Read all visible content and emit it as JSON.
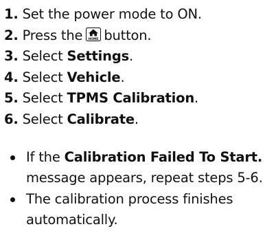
{
  "steps": [
    {
      "num": "1.",
      "text": "Set the power mode to ON."
    },
    {
      "num": "2.",
      "text_before": "Press the",
      "icon": "home-icon",
      "icon_label": "HOME",
      "text_after": "button."
    },
    {
      "num": "3.",
      "text": "Select",
      "bold": "Settings",
      "end": "."
    },
    {
      "num": "4.",
      "text": "Select",
      "bold": "Vehicle",
      "end": "."
    },
    {
      "num": "5.",
      "text": "Select",
      "bold": "TPMS Calibration",
      "end": "."
    },
    {
      "num": "6.",
      "text": "Select",
      "bold": "Calibrate",
      "end": "."
    }
  ],
  "notes": [
    {
      "text_before": "If the",
      "bold": "Calibration Failed To Start.",
      "text_after": "message appears, repeat steps 5-6."
    },
    {
      "text": "The calibration process finishes automatically."
    }
  ],
  "colors": {
    "text": "#111111",
    "background": "#ffffff"
  }
}
